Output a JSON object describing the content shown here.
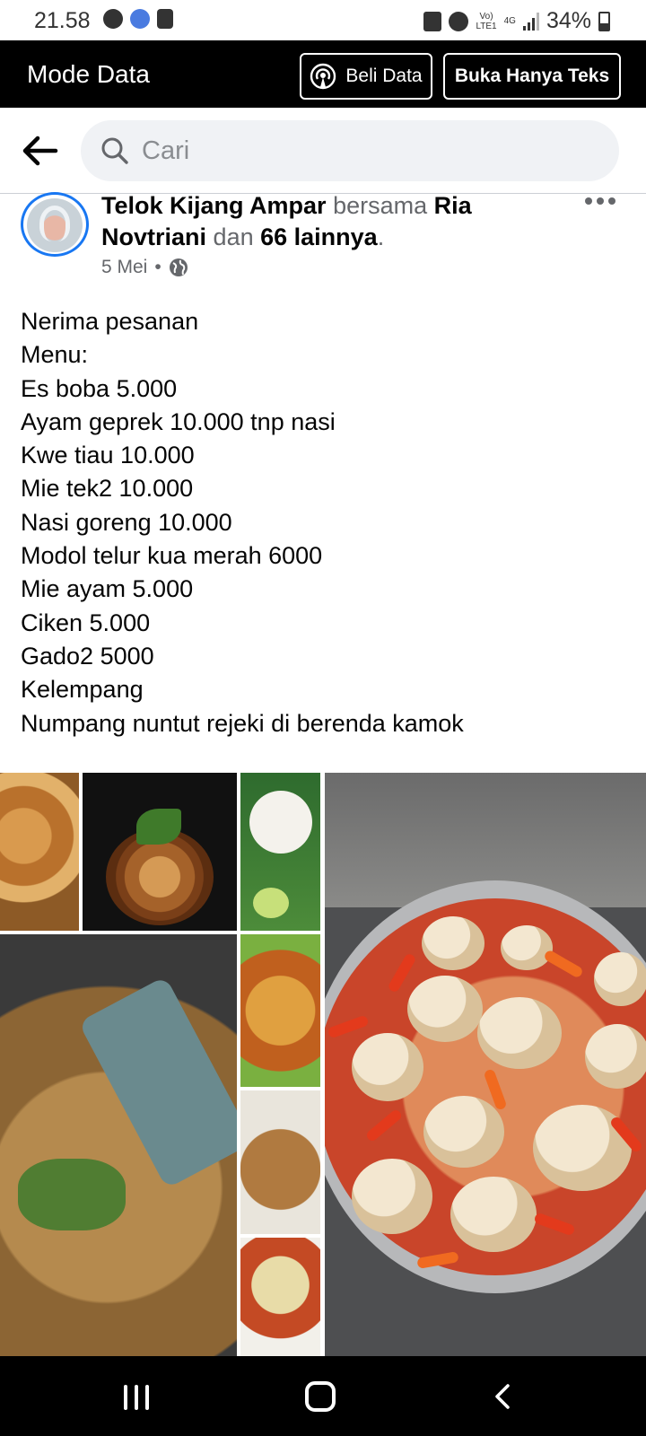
{
  "status_bar": {
    "time": "21.58",
    "net_top": "Vo)",
    "net_bottom": "LTE1",
    "network_type": "4G",
    "battery": "34%"
  },
  "data_bar": {
    "title": "Mode Data",
    "buy_data_label": "Beli Data",
    "text_only_label": "Buka Hanya Teks"
  },
  "search": {
    "placeholder": "Cari"
  },
  "post": {
    "author": "Telok Kijang Ampar",
    "with_word": "bersama",
    "tagged": "Ria Novtriani",
    "and_word": "dan",
    "others": "66 lainnya",
    "end_period": ".",
    "date": "5 Mei",
    "separator": "•",
    "body_lines": [
      "Nerima pesanan",
      "Menu:",
      "Es boba 5.000",
      "Ayam geprek 10.000 tnp nasi",
      "Kwe tiau 10.000",
      "Mie tek2 10.000",
      "Nasi goreng 10.000",
      "Modol telur kua merah 6000",
      "Mie ayam 5.000",
      "Ciken 5.000",
      "Gado2 5000",
      "Kelempang",
      "Numpang nuntut rejeki di berenda kamok"
    ]
  },
  "icons": {
    "back": "back-arrow-icon",
    "search": "search-icon",
    "more": "more-horizontal-icon",
    "globe": "globe-icon",
    "buy_data": "broadcast-icon"
  },
  "colors": {
    "accent": "#1877f2",
    "data_bar_bg": "#000000",
    "search_bg": "#f0f2f5",
    "muted_text": "#65676b"
  }
}
